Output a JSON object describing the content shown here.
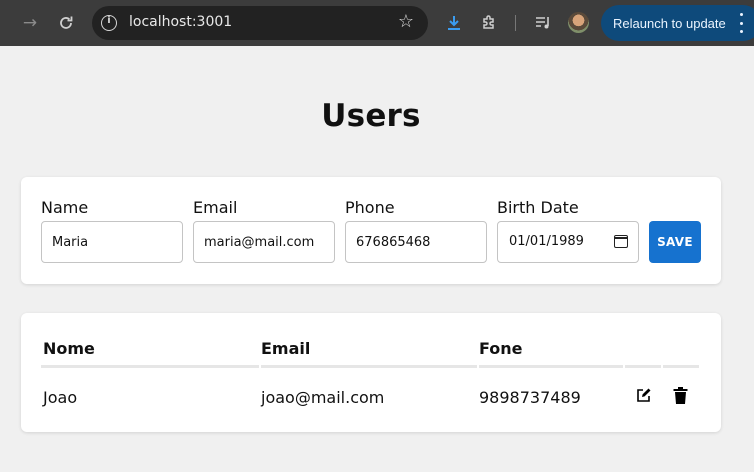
{
  "browser": {
    "url": "localhost:3001",
    "relaunch_label": "Relaunch to update"
  },
  "page": {
    "title": "Users"
  },
  "form": {
    "name_label": "Name",
    "name_value": "Maria",
    "email_label": "Email",
    "email_value": "maria@mail.com",
    "phone_label": "Phone",
    "phone_value": "676865468",
    "birth_label": "Birth Date",
    "birth_value": "01/01/1989",
    "save_label": "SAVE",
    "save_color": "#1672cf"
  },
  "table": {
    "headers": [
      "Nome",
      "Email",
      "Fone"
    ],
    "rows": [
      {
        "nome": "Joao",
        "email": "joao@mail.com",
        "fone": "9898737489"
      }
    ]
  }
}
